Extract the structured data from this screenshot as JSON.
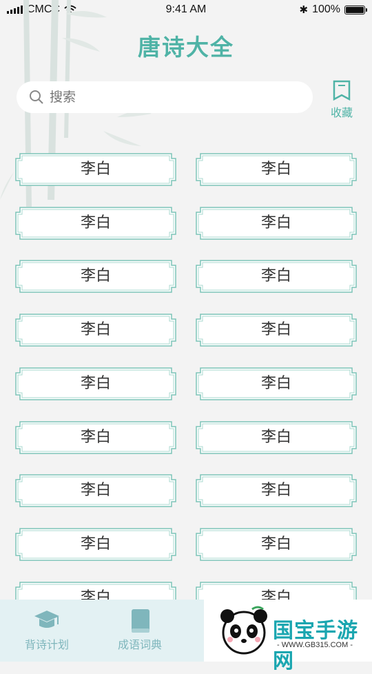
{
  "status_bar": {
    "carrier": "CMCC",
    "time": "9:41 AM",
    "battery": "100%",
    "battery_level": 1.0
  },
  "header": {
    "title": "唐诗大全"
  },
  "search": {
    "placeholder": "搜索"
  },
  "favorites": {
    "label": "收藏"
  },
  "poets": [
    "李白",
    "李白",
    "李白",
    "李白",
    "李白",
    "李白",
    "李白",
    "李白",
    "李白",
    "李白",
    "李白",
    "李白",
    "李白",
    "李白",
    "李白",
    "李白",
    "李白",
    "李白"
  ],
  "tabbar": {
    "tabs": [
      {
        "label": "背诗计划",
        "icon": "graduation-cap-icon"
      },
      {
        "label": "成语词典",
        "icon": "book-icon"
      }
    ]
  },
  "watermark": {
    "brand": "国宝手游网",
    "url": "- WWW.GB315.COM -"
  },
  "colors": {
    "accent": "#4fb3a6",
    "tab_bg": "#e3f1f3",
    "tab_text": "#7fb6bc"
  }
}
